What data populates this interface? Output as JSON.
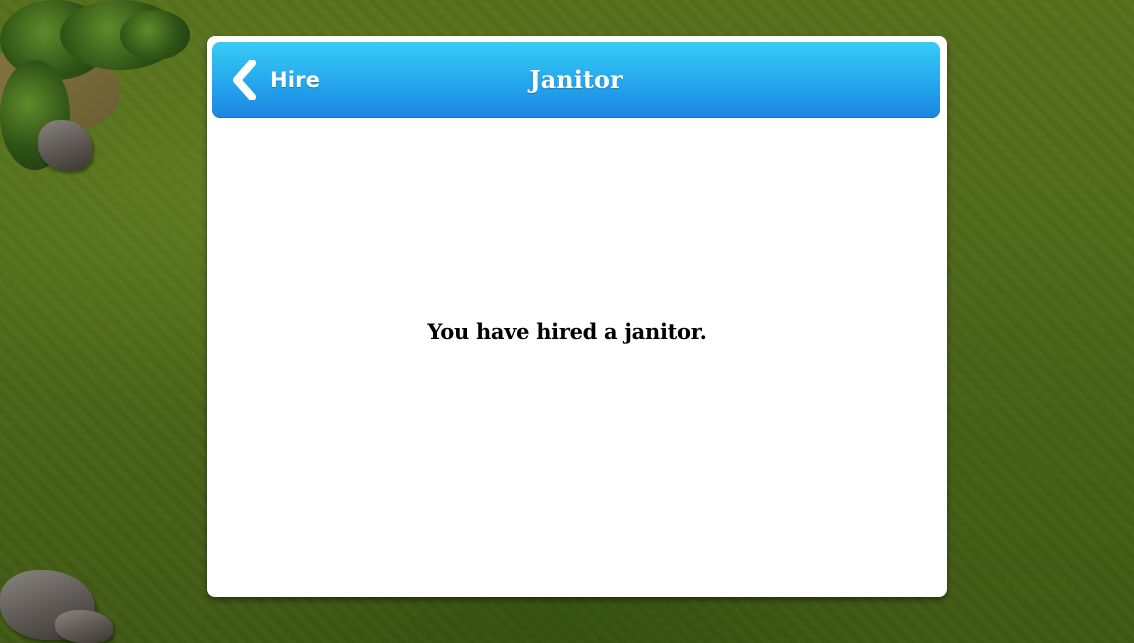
{
  "header": {
    "back_label": "Hire",
    "back_icon": "chevron-left-icon",
    "title": "Janitor"
  },
  "body": {
    "message": "You have hired a janitor."
  },
  "colors": {
    "header_top": "#38ccf6",
    "header_bottom": "#1b85e1",
    "panel_bg": "#ffffff",
    "text": "#000000",
    "grass": "#4f6a1a"
  }
}
